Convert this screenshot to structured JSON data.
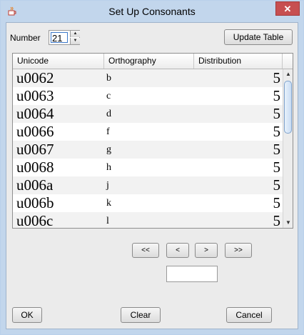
{
  "window": {
    "title": "Set Up Consonants",
    "close_label": "✕",
    "icon": "java-cup-icon"
  },
  "controls": {
    "number_label": "Number",
    "number_value": "21",
    "update_table_label": "Update Table"
  },
  "table": {
    "columns": [
      "Unicode",
      "Orthography",
      "Distribution"
    ],
    "rows": [
      {
        "unicode": "u0062",
        "orthography": "b",
        "distribution": "5"
      },
      {
        "unicode": "u0063",
        "orthography": "c",
        "distribution": "5"
      },
      {
        "unicode": "u0064",
        "orthography": "d",
        "distribution": "5"
      },
      {
        "unicode": "u0066",
        "orthography": "f",
        "distribution": "5"
      },
      {
        "unicode": "u0067",
        "orthography": "g",
        "distribution": "5"
      },
      {
        "unicode": "u0068",
        "orthography": "h",
        "distribution": "5"
      },
      {
        "unicode": "u006a",
        "orthography": "j",
        "distribution": "5"
      },
      {
        "unicode": "u006b",
        "orthography": "k",
        "distribution": "5"
      },
      {
        "unicode": "u006c",
        "orthography": "l",
        "distribution": "5"
      }
    ]
  },
  "pager": {
    "first_label": "<<",
    "prev_label": "<",
    "next_label": ">",
    "last_label": ">>",
    "page_value": ""
  },
  "footer": {
    "ok_label": "OK",
    "clear_label": "Clear",
    "cancel_label": "Cancel"
  }
}
